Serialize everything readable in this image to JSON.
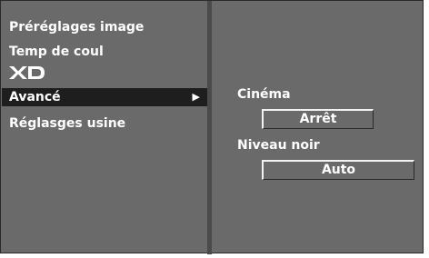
{
  "menu": {
    "items": [
      {
        "label": "Préréglages image"
      },
      {
        "label": "Temp de coul"
      },
      {
        "label": "XD"
      },
      {
        "label": "Avancé",
        "selected": true
      },
      {
        "label": "Réglasges usine"
      }
    ],
    "selected_arrow": "▶"
  },
  "advanced": {
    "cinema": {
      "label": "Cinéma",
      "value": "Arrêt"
    },
    "niveau_noir": {
      "label": "Niveau noir",
      "value": "Auto"
    }
  },
  "colors": {
    "panel_bg": "#6a6a6a",
    "highlight_bg": "#1e1e1e",
    "text": "#ffffff"
  }
}
